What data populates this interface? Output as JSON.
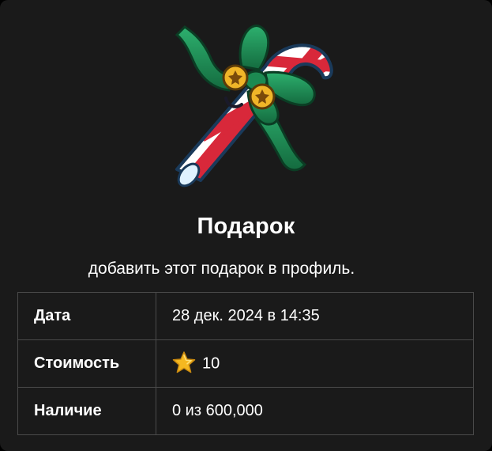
{
  "gift": {
    "sticker_icon": "candy-cane-with-green-bow-icon",
    "title": "Подарок",
    "description": "добавить этот подарок в профиль."
  },
  "details": {
    "rows": [
      {
        "label": "Дата",
        "value": "28 дек. 2024 в 14:35"
      },
      {
        "label": "Стоимость",
        "icon": "star-icon",
        "value": "10"
      },
      {
        "label": "Наличие",
        "value": "0 из 600,000"
      }
    ]
  },
  "colors": {
    "background": "#1a1a1a",
    "table_border": "#4a4a4a",
    "text": "#ffffff",
    "star": "#f5b820",
    "bow": "#1f8a55",
    "cane_red": "#d8283a"
  }
}
